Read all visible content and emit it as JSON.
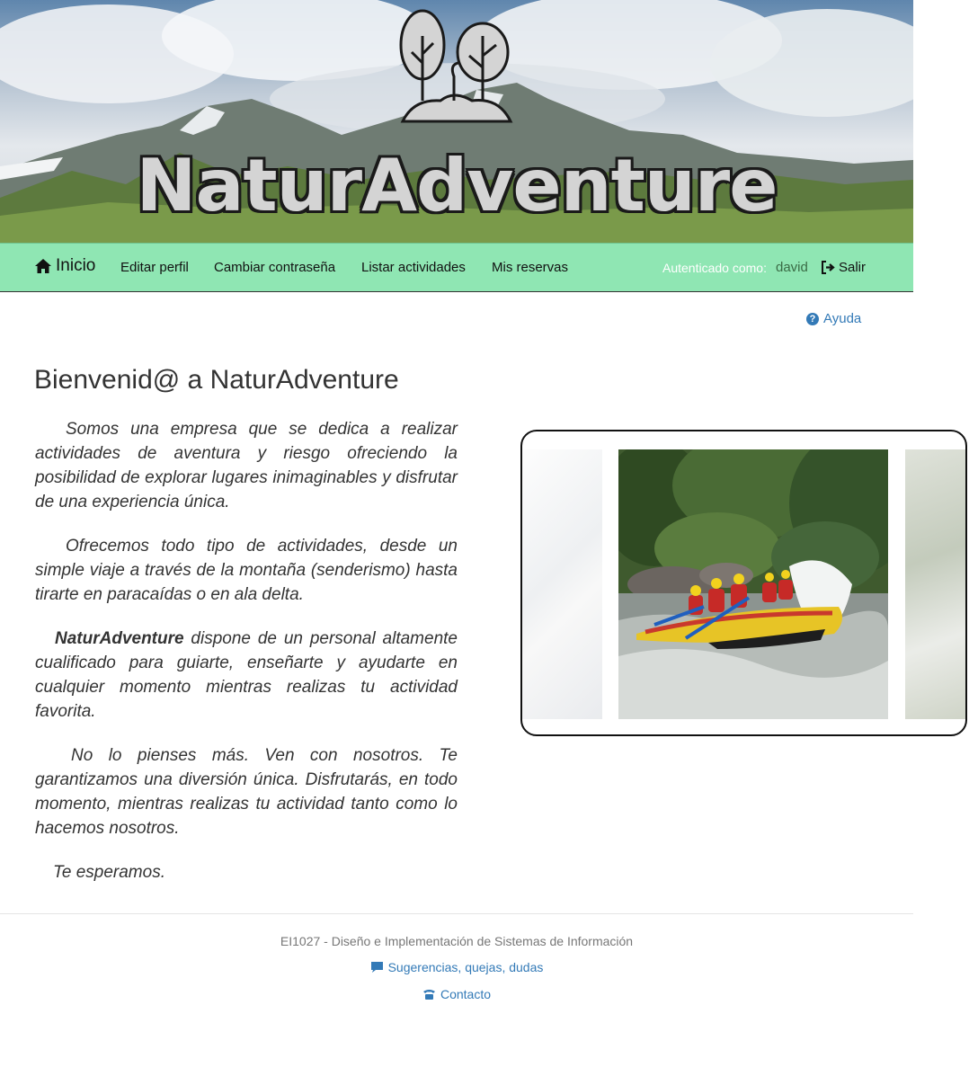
{
  "brand": {
    "name": "NaturAdventure"
  },
  "nav": {
    "home": "Inicio",
    "items": [
      "Editar perfil",
      "Cambiar contraseña",
      "Listar actividades",
      "Mis reservas"
    ],
    "auth_label": "Autenticado como:",
    "user": "david",
    "logout": "Salir"
  },
  "help": {
    "label": "Ayuda"
  },
  "main": {
    "title": "Bienvenid@ a NaturAdventure",
    "paragraphs": [
      "Somos una empresa que se dedica a realizar actividades de aventura y riesgo ofreciendo la posibilidad de explorar lugares inimaginables y disfrutar de una experiencia única.",
      "Ofrecemos todo tipo de actividades, desde un simple viaje a través de la montaña (senderismo) hasta tirarte en paracaídas o en ala delta.",
      " dispone de un personal altamente cualificado para guiarte, enseñarte y ayudarte en cualquier momento mientras realizas tu actividad favorita.",
      "No lo pienses más. Ven con nosotros. Te garantizamos una diversión única. Disfrutarás, en todo momento, mientras realizas tu actividad tanto como lo hacemos nosotros.",
      "Te esperamos."
    ],
    "p3_bold": "NaturAdventure"
  },
  "footer": {
    "course": "EI1027 - Diseño e Implementación de Sistemas de Información",
    "suggestions": "Sugerencias, quejas, dudas",
    "contact": "Contacto"
  },
  "colors": {
    "navbar": "#8fe6b3",
    "link": "#337ab7"
  },
  "icons": {
    "home": "home-icon",
    "logout": "logout-icon",
    "help": "question-circle-icon",
    "comment": "comment-icon",
    "phone": "phone-icon"
  }
}
